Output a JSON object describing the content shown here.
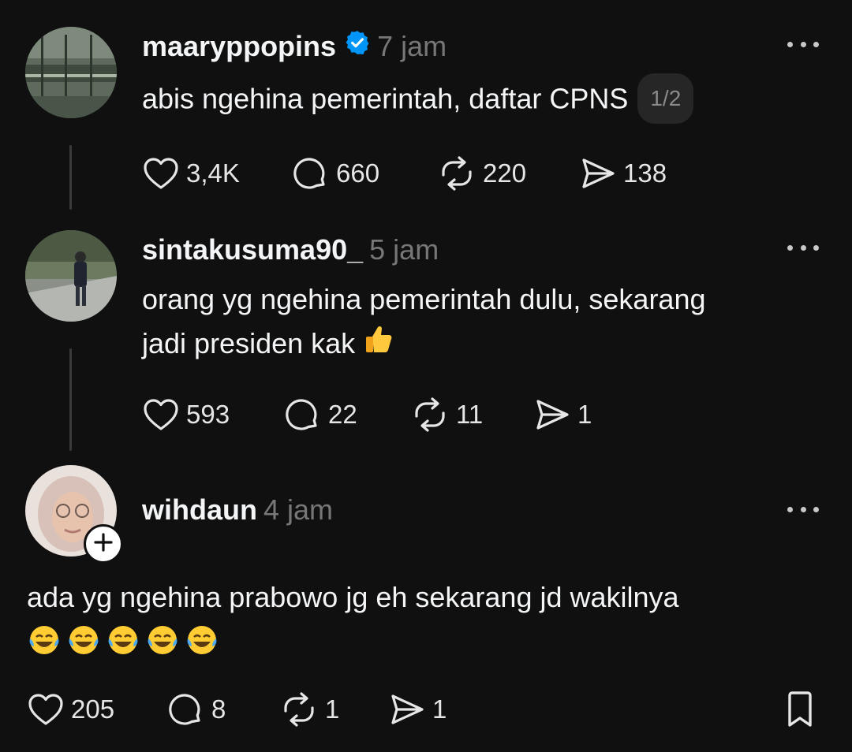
{
  "posts": [
    {
      "username": "maaryppopins",
      "time": "7 jam",
      "verified": true,
      "text": "abis ngehina pemerintah, daftar CPNS",
      "page_indicator": "1/2",
      "likes": "3,4K",
      "comments": "660",
      "reposts": "220",
      "shares": "138"
    },
    {
      "username": "sintakusuma90_",
      "time": "5 jam",
      "text_line1": "orang yg ngehina pemerintah dulu, sekarang",
      "text_line2": "jadi presiden kak",
      "likes": "593",
      "comments": "22",
      "reposts": "11",
      "shares": "1"
    },
    {
      "username": "wihdaun",
      "time": "4 jam",
      "text": "ada yg ngehina prabowo jg eh sekarang jd wakilnya",
      "likes": "205",
      "comments": "8",
      "reposts": "1",
      "shares": "1"
    }
  ],
  "icons": {
    "like": "heart-icon",
    "comment": "comment-icon",
    "repost": "repost-icon",
    "share": "share-icon",
    "more": "more-icon",
    "save": "bookmark-icon",
    "verified": "verified-badge-icon",
    "follow": "plus-icon",
    "thumbs_up": "thumbs-up-emoji",
    "laughing": "tears-of-joy-emoji"
  },
  "colors": {
    "background": "#101010",
    "text": "#f3f5f7",
    "muted": "#777777",
    "verified": "#0095f6"
  }
}
